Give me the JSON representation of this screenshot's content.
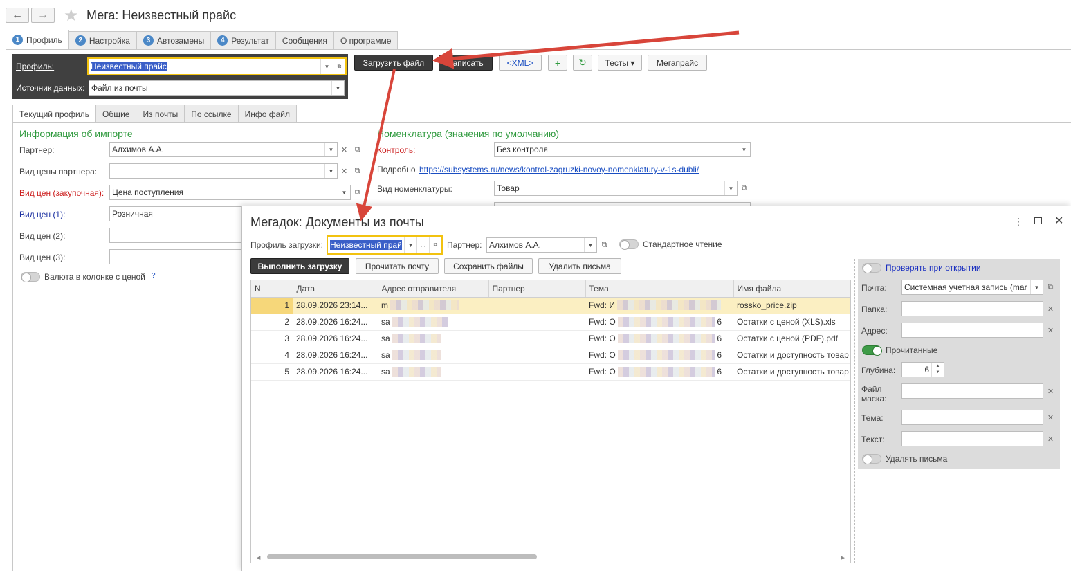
{
  "window": {
    "title": "Мега: Неизвестный прайс",
    "back_glyph": "←",
    "forward_glyph": "→",
    "star_glyph": "★"
  },
  "main_tabs": [
    {
      "num": "1",
      "label": "Профиль"
    },
    {
      "num": "2",
      "label": "Настройка"
    },
    {
      "num": "3",
      "label": "Автозамены"
    },
    {
      "num": "4",
      "label": "Результат"
    },
    {
      "num": "",
      "label": "Сообщения"
    },
    {
      "num": "",
      "label": "О программе"
    }
  ],
  "profile": {
    "label": "Профиль:",
    "value": "Неизвестный прайс",
    "source_label": "Источник данных:",
    "source_value": "Файл из почты"
  },
  "toolbar": {
    "load_file": "Загрузить файл",
    "save": "Записать",
    "xml": "<XML>",
    "plus": "+",
    "refresh": "↻",
    "tests": "Тесты ▾",
    "megaprice": "Мегапрайс"
  },
  "sub_tabs": [
    "Текущий профиль",
    "Общие",
    "Из почты",
    "По ссылке",
    "Инфо файл"
  ],
  "import_info": {
    "heading": "Информация об импорте",
    "partner_label": "Партнер:",
    "partner_value": "Алхимов А.А.",
    "partner_price_label": "Вид цены партнера:",
    "partner_price_value": "",
    "purchase_price_label": "Вид цен (закупочная):",
    "purchase_price_value": "Цена поступления",
    "price1_label": "Вид цен (1):",
    "price1_value": "Розничная",
    "price2_label": "Вид цен (2):",
    "price3_label": "Вид цен (3):",
    "currency_toggle_label": "Валюта в колонке с ценой",
    "help_glyph": "?"
  },
  "nomenclature": {
    "heading": "Номенклатура (значения по умолчанию)",
    "control_label": "Контроль:",
    "control_value": "Без контроля",
    "details_label": "Подробно",
    "details_link": "https://subsystems.ru/news/kontrol-zagruzki-novoy-nomenklatury-v-1s-dubli/",
    "kind_label": "Вид номенклатуры:",
    "kind_value": "Товар"
  },
  "modal": {
    "title": "Мегадок: Документы из почты",
    "profile_label": "Профиль загрузки:",
    "profile_value": "Неизвестный прай",
    "partner_label": "Партнер:",
    "partner_value": "Алхимов А.А.",
    "standard_read_label": "Стандартное чтение",
    "buttons": {
      "run": "Выполнить загрузку",
      "read_mail": "Прочитать почту",
      "save_files": "Сохранить файлы",
      "delete_mails": "Удалить письма"
    },
    "columns": [
      "N",
      "Дата",
      "Адрес отправителя",
      "Партнер",
      "Тема",
      "Имя файла"
    ],
    "rows": [
      {
        "n": "1",
        "date": "28.09.2026 23:14...",
        "from": "m",
        "partner": "",
        "subject": "Fwd: И",
        "subject_tail": "",
        "file": "rossko_price.zip"
      },
      {
        "n": "2",
        "date": "28.09.2026 16:24...",
        "from": "sa",
        "partner": "",
        "subject": "Fwd: О",
        "subject_tail": "6",
        "file": "Остатки с ценой (XLS).xls"
      },
      {
        "n": "3",
        "date": "28.09.2026 16:24...",
        "from": "sa",
        "partner": "",
        "subject": "Fwd: О",
        "subject_tail": "6",
        "file": "Остатки с ценой (PDF).pdf"
      },
      {
        "n": "4",
        "date": "28.09.2026 16:24...",
        "from": "sa",
        "partner": "",
        "subject": "Fwd: О",
        "subject_tail": "6",
        "file": "Остатки и доступность товар"
      },
      {
        "n": "5",
        "date": "28.09.2026 16:24...",
        "from": "sa",
        "partner": "",
        "subject": "Fwd: О",
        "subject_tail": "6",
        "file": "Остатки и доступность товар"
      }
    ],
    "side": {
      "check_on_open": "Проверять при открытии",
      "mail_label": "Почта:",
      "mail_value": "Системная учетная запись (mar",
      "folder_label": "Папка:",
      "address_label": "Адрес:",
      "read_label": "Прочитанные",
      "depth_label": "Глубина:",
      "depth_value": "6",
      "mask_label": "Файл маска:",
      "subject_label": "Тема:",
      "text_label": "Текст:",
      "delete_label": "Удалять письма"
    }
  },
  "colors": {
    "accent_green": "#2f9a3e",
    "link_blue": "#1a4ec2",
    "required_red": "#cc1e1e",
    "arrow_red": "#d8453a",
    "highlight_yellow": "#f2c20f"
  }
}
